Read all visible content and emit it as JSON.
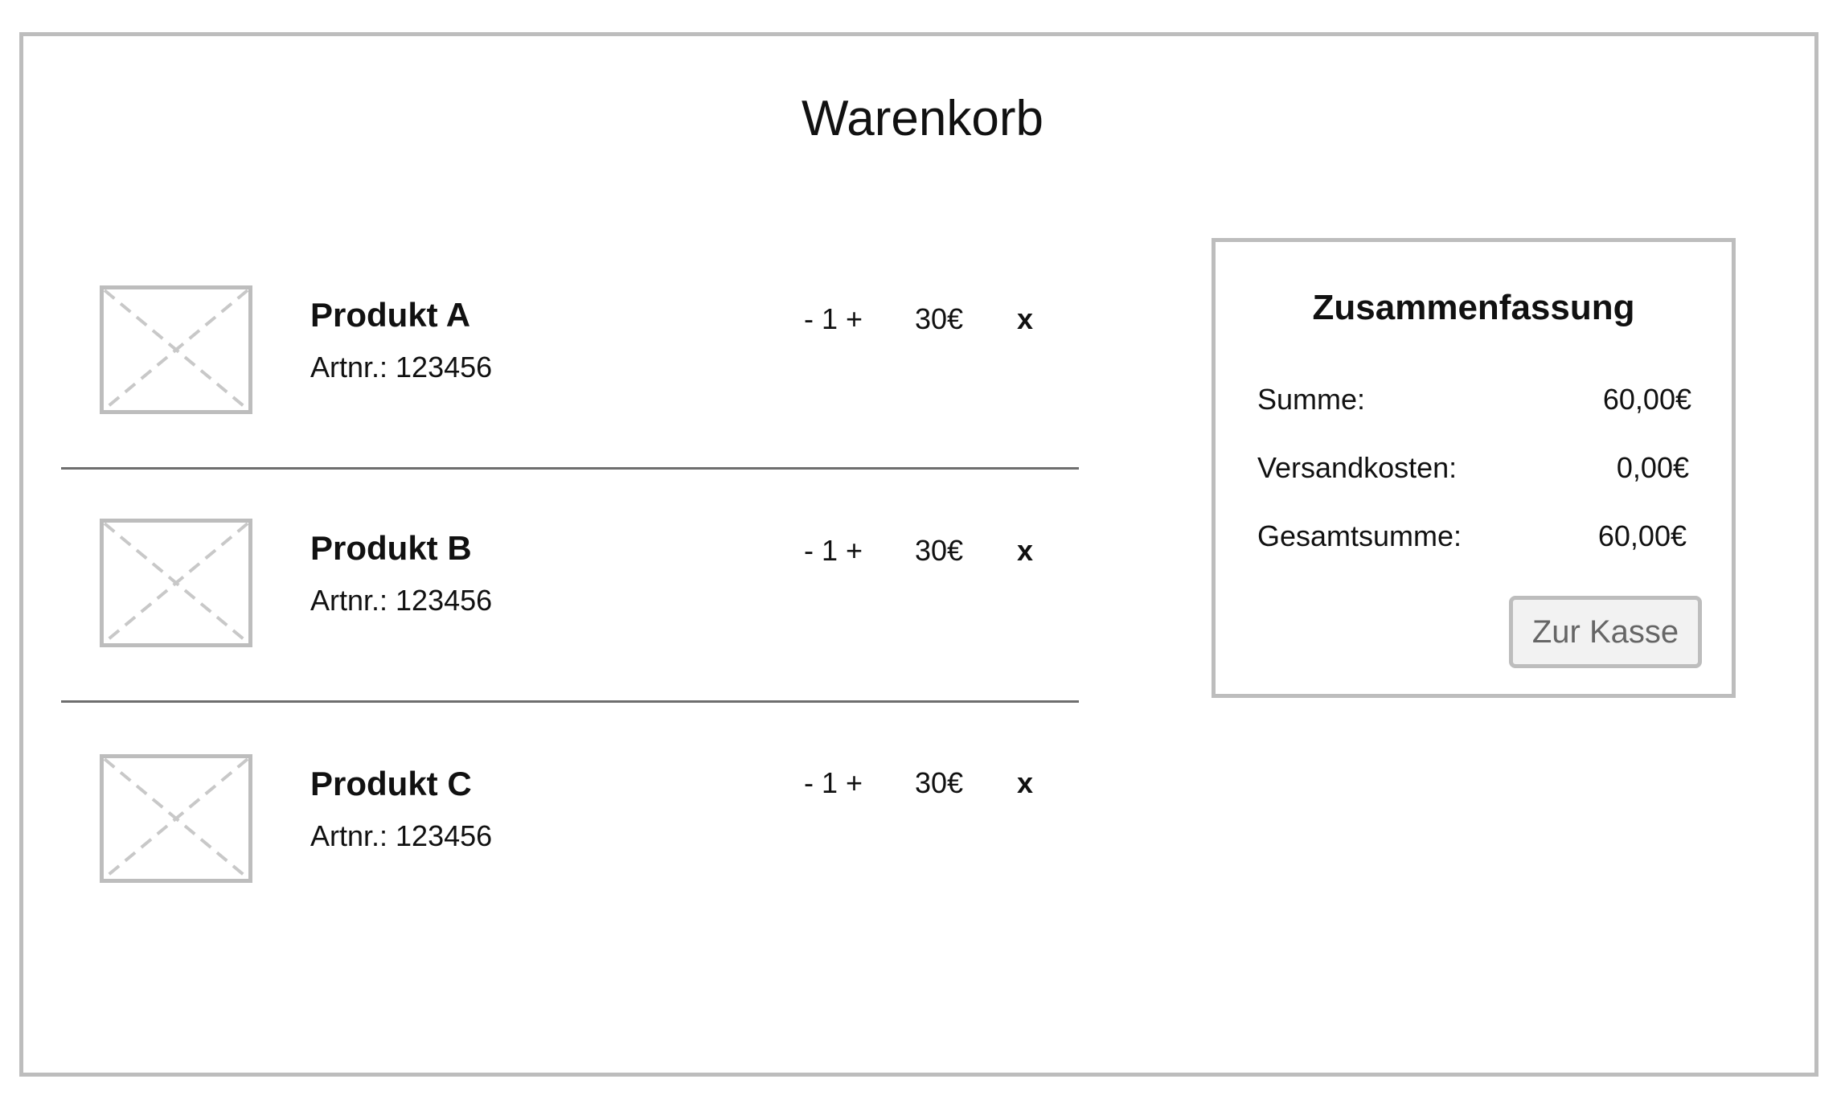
{
  "page": {
    "title": "Warenkorb"
  },
  "cart": {
    "items": [
      {
        "name": "Produkt A",
        "artnr_label": "Artnr.:",
        "artnr": "123456",
        "qty_minus": "-",
        "quantity": "1",
        "qty_plus": "+",
        "price": "30€",
        "remove_label": "x"
      },
      {
        "name": "Produkt B",
        "artnr_label": "Artnr.:",
        "artnr": "123456",
        "qty_minus": "-",
        "quantity": "1",
        "qty_plus": "+",
        "price": "30€",
        "remove_label": "x"
      },
      {
        "name": "Produkt C",
        "artnr_label": "Artnr.:",
        "artnr": "123456",
        "qty_minus": "-",
        "quantity": "1",
        "qty_plus": "+",
        "price": "30€",
        "remove_label": "x"
      }
    ]
  },
  "summary": {
    "title": "Zusammenfassung",
    "subtotal_label": "Summe:",
    "subtotal_value": "60,00€",
    "shipping_label": "Versandkosten:",
    "shipping_value": "0,00€",
    "total_label": "Gesamtsumme:",
    "total_value": "60,00€",
    "checkout_label": "Zur Kasse"
  },
  "icons": {
    "product_image": "image-placeholder-icon"
  },
  "colors": {
    "border": "#bdbdbd",
    "divider": "#6e6e6e",
    "button_bg": "#f2f2f2",
    "button_text": "#666666"
  }
}
